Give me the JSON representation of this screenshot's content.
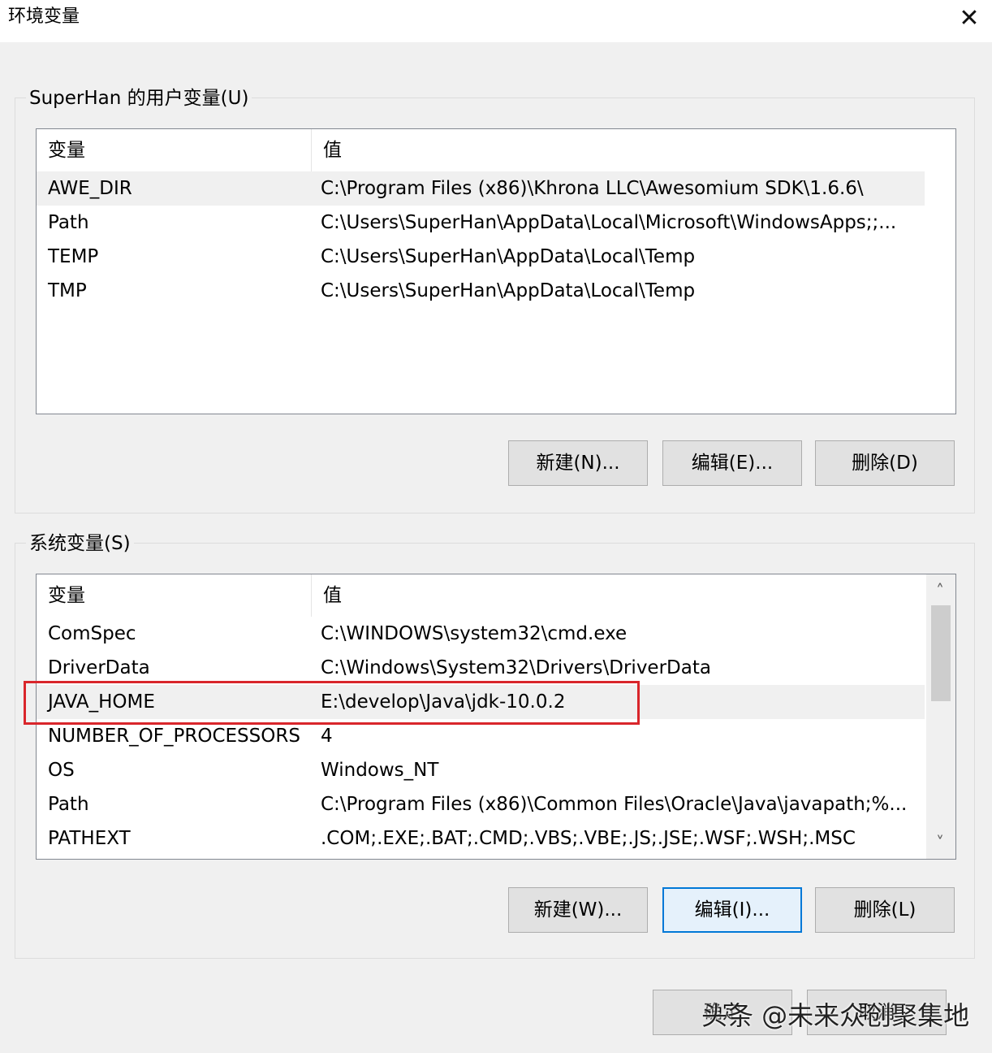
{
  "window": {
    "title": "环境变量",
    "close_glyph": "✕"
  },
  "user_vars": {
    "group_label": "SuperHan 的用户变量(U)",
    "columns": [
      "变量",
      "值"
    ],
    "rows": [
      {
        "name": "AWE_DIR",
        "value": "C:\\Program Files (x86)\\Khrona LLC\\Awesomium SDK\\1.6.6\\"
      },
      {
        "name": "Path",
        "value": "C:\\Users\\SuperHan\\AppData\\Local\\Microsoft\\WindowsApps;;..."
      },
      {
        "name": "TEMP",
        "value": "C:\\Users\\SuperHan\\AppData\\Local\\Temp"
      },
      {
        "name": "TMP",
        "value": "C:\\Users\\SuperHan\\AppData\\Local\\Temp"
      }
    ],
    "buttons": {
      "new": "新建(N)...",
      "edit": "编辑(E)...",
      "delete": "删除(D)"
    }
  },
  "system_vars": {
    "group_label": "系统变量(S)",
    "columns": [
      "变量",
      "值"
    ],
    "rows": [
      {
        "name": "ComSpec",
        "value": "C:\\WINDOWS\\system32\\cmd.exe"
      },
      {
        "name": "DriverData",
        "value": "C:\\Windows\\System32\\Drivers\\DriverData"
      },
      {
        "name": "JAVA_HOME",
        "value": "E:\\develop\\Java\\jdk-10.0.2"
      },
      {
        "name": "NUMBER_OF_PROCESSORS",
        "value": "4"
      },
      {
        "name": "OS",
        "value": "Windows_NT"
      },
      {
        "name": "Path",
        "value": "C:\\Program Files (x86)\\Common Files\\Oracle\\Java\\javapath;%..."
      },
      {
        "name": "PATHEXT",
        "value": ".COM;.EXE;.BAT;.CMD;.VBS;.VBE;.JS;.JSE;.WSF;.WSH;.MSC"
      }
    ],
    "buttons": {
      "new": "新建(W)...",
      "edit": "编辑(I)...",
      "delete": "删除(L)"
    },
    "scroll_up_glyph": "˄",
    "scroll_down_glyph": "˅"
  },
  "footer": {
    "ok": "确定",
    "cancel": "取消"
  },
  "watermark": "头条 @未来众创聚集地",
  "colors": {
    "highlight": "#d9262b",
    "focus": "#0078d7"
  }
}
